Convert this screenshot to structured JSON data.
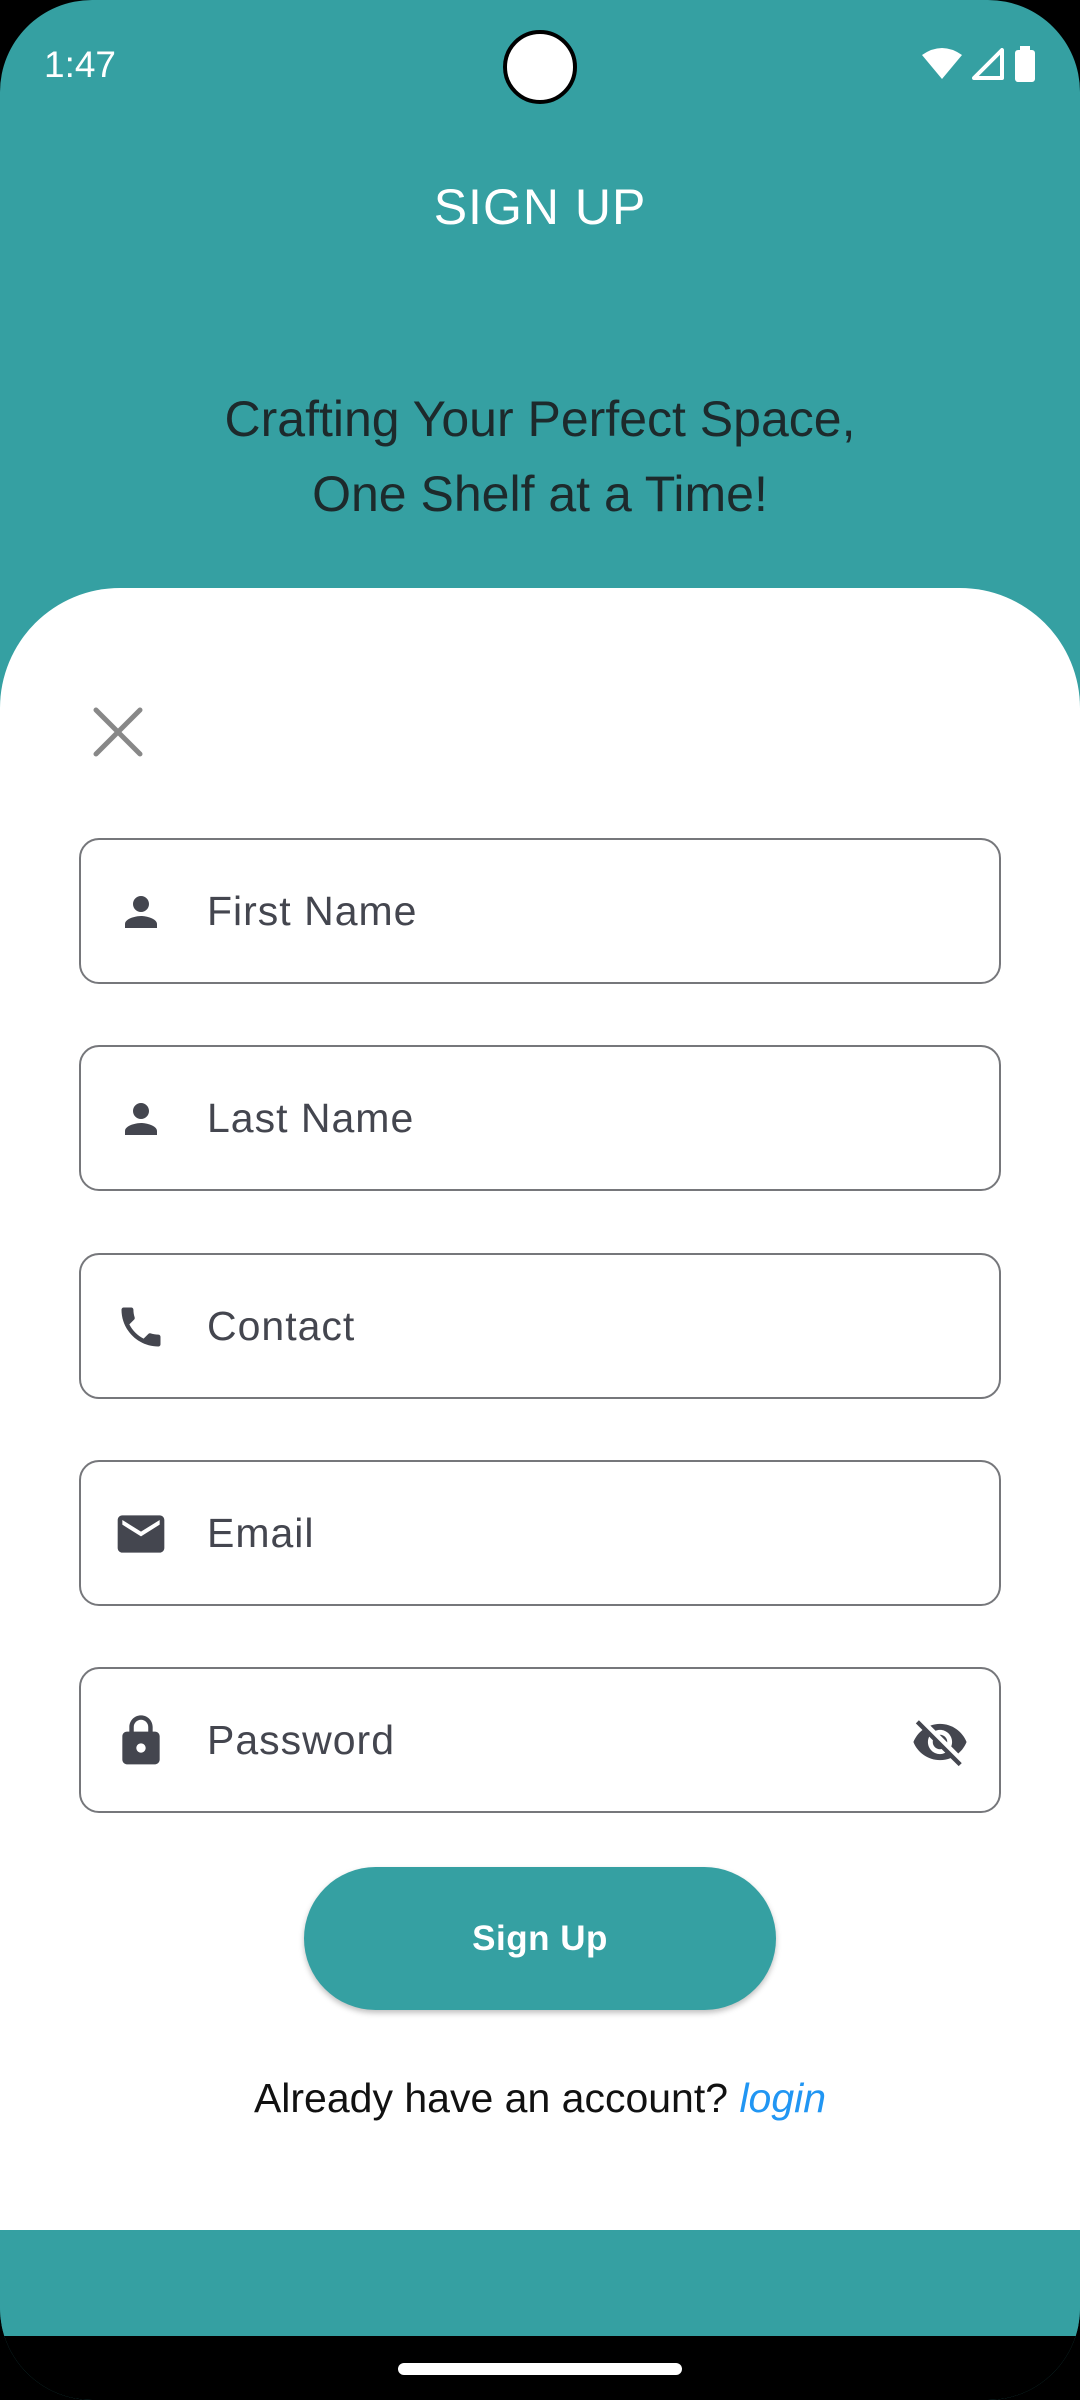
{
  "status_bar": {
    "time": "1:47",
    "icons": [
      "wifi-icon",
      "signal-icon",
      "battery-icon"
    ]
  },
  "header": {
    "title": "SIGN UP",
    "tagline_line1": "Crafting Your Perfect Space,",
    "tagline_line2": "One Shelf at a Time!"
  },
  "form": {
    "close_icon": "close-icon",
    "fields": [
      {
        "name": "first-name",
        "placeholder": "First Name",
        "icon": "person-icon",
        "value": ""
      },
      {
        "name": "last-name",
        "placeholder": "Last Name",
        "icon": "person-icon",
        "value": ""
      },
      {
        "name": "contact",
        "placeholder": "Contact",
        "icon": "phone-icon",
        "value": ""
      },
      {
        "name": "email",
        "placeholder": "Email",
        "icon": "mail-icon",
        "value": ""
      },
      {
        "name": "password",
        "placeholder": "Password",
        "icon": "lock-icon",
        "value": "",
        "toggle_icon": "visibility-off-icon"
      }
    ],
    "submit_label": "Sign Up",
    "login_prompt": "Already have an account?",
    "login_link": "login"
  },
  "colors": {
    "primary": "#35A0A2",
    "link": "#2196F3",
    "field_border": "#76777b",
    "icon": "#44464f"
  }
}
